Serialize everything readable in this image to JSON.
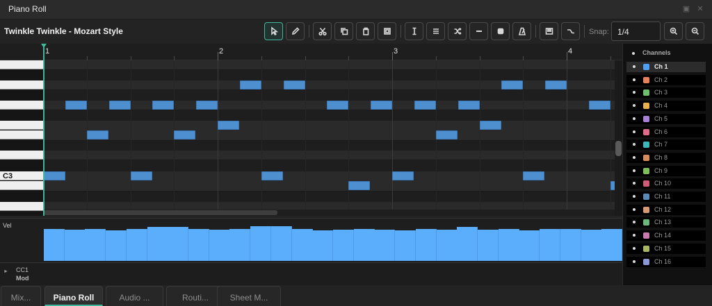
{
  "window": {
    "title": "Piano Roll",
    "restore_glyph": "▣",
    "close_glyph": "✕"
  },
  "toolbar": {
    "project_title": "Twinkle Twinkle - Mozart Style",
    "tools": [
      {
        "name": "select-tool",
        "icon": "cursor-icon",
        "active": true
      },
      {
        "name": "pencil-tool",
        "icon": "pencil-icon"
      },
      {
        "name": "cut-tool",
        "icon": "scissors-icon"
      },
      {
        "name": "copy-tool",
        "icon": "copy-icon"
      },
      {
        "name": "paste-tool",
        "icon": "paste-icon"
      },
      {
        "name": "duplicate-tool",
        "icon": "duplicate-icon"
      },
      {
        "name": "text-cursor-tool",
        "icon": "text-cursor-icon"
      },
      {
        "name": "list-tool",
        "icon": "list-icon"
      },
      {
        "name": "shuffle-tool",
        "icon": "shuffle-icon"
      },
      {
        "name": "minus-tool",
        "icon": "minus-icon"
      },
      {
        "name": "stop-tool",
        "icon": "stop-icon"
      },
      {
        "name": "metronome-tool",
        "icon": "metronome-icon"
      },
      {
        "name": "piano-tool",
        "icon": "piano-icon"
      },
      {
        "name": "curve-tool",
        "icon": "curve-icon"
      },
      {
        "name": "zoom-in-button",
        "icon": "zoom-in-icon"
      },
      {
        "name": "zoom-out-button",
        "icon": "zoom-out-icon"
      }
    ],
    "snap_label": "Snap:",
    "snap_value": "1/4"
  },
  "ruler": {
    "bars": [
      "1",
      "2",
      "3",
      "4"
    ]
  },
  "keyboard": {
    "c3_label": "C3"
  },
  "velocity": {
    "label": "Vel",
    "values": [
      92,
      90,
      92,
      88,
      92,
      98,
      98,
      92,
      90,
      92,
      100,
      100,
      92,
      88,
      90,
      92,
      90,
      88,
      92,
      90,
      98,
      90,
      92,
      88,
      92,
      92,
      90,
      92
    ]
  },
  "cc_lane": {
    "arrow": "►",
    "line1": "CC1",
    "line2": "Mod"
  },
  "channels": {
    "header": "Channels",
    "selected": 0,
    "items": [
      {
        "name": "Ch 1",
        "color": "#4e9ff0"
      },
      {
        "name": "Ch 2",
        "color": "#e8825a"
      },
      {
        "name": "Ch 3",
        "color": "#6cc06c"
      },
      {
        "name": "Ch 4",
        "color": "#e8b04a"
      },
      {
        "name": "Ch 5",
        "color": "#a880d8"
      },
      {
        "name": "Ch 6",
        "color": "#e06a8a"
      },
      {
        "name": "Ch 7",
        "color": "#3ab8b8"
      },
      {
        "name": "Ch 8",
        "color": "#d88a5a"
      },
      {
        "name": "Ch 9",
        "color": "#7cc05a"
      },
      {
        "name": "Ch 10",
        "color": "#d05a7a"
      },
      {
        "name": "Ch 11",
        "color": "#5a8ab8"
      },
      {
        "name": "Ch 12",
        "color": "#d89a70"
      },
      {
        "name": "Ch 13",
        "color": "#6cb87a"
      },
      {
        "name": "Ch 14",
        "color": "#c87ab0"
      },
      {
        "name": "Ch 15",
        "color": "#a8b860"
      },
      {
        "name": "Ch 16",
        "color": "#8a98d8"
      }
    ]
  },
  "tabs": [
    {
      "label": "Mix...",
      "active": false
    },
    {
      "label": "Piano Roll",
      "active": true
    },
    {
      "label": "Audio ...",
      "active": false
    },
    {
      "label": "Routi...",
      "active": false
    },
    {
      "label": "Sheet M...",
      "active": false
    }
  ]
}
